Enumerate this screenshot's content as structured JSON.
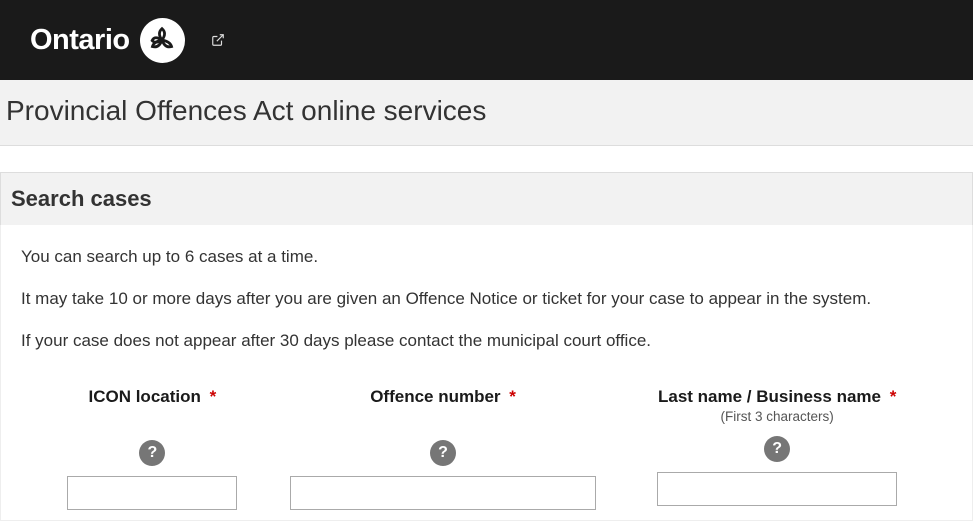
{
  "header": {
    "brand": "Ontario"
  },
  "page": {
    "title": "Provincial Offences Act online services"
  },
  "search": {
    "section_title": "Search cases",
    "intro_line1": "You can search up to 6 cases at a time.",
    "intro_line2": "It may take 10 or more days after you are given an Offence Notice or ticket for your case to appear in the system.",
    "intro_line3": "If your case does not appear after 30 days please contact the municipal court office.",
    "fields": {
      "icon_location": {
        "label": "ICON location",
        "required": "*",
        "value": ""
      },
      "offence_number": {
        "label": "Offence number",
        "required": "*",
        "value": ""
      },
      "last_name": {
        "label": "Last name / Business name",
        "required": "*",
        "sublabel": "(First 3 characters)",
        "value": ""
      }
    },
    "help_glyph": "?"
  }
}
